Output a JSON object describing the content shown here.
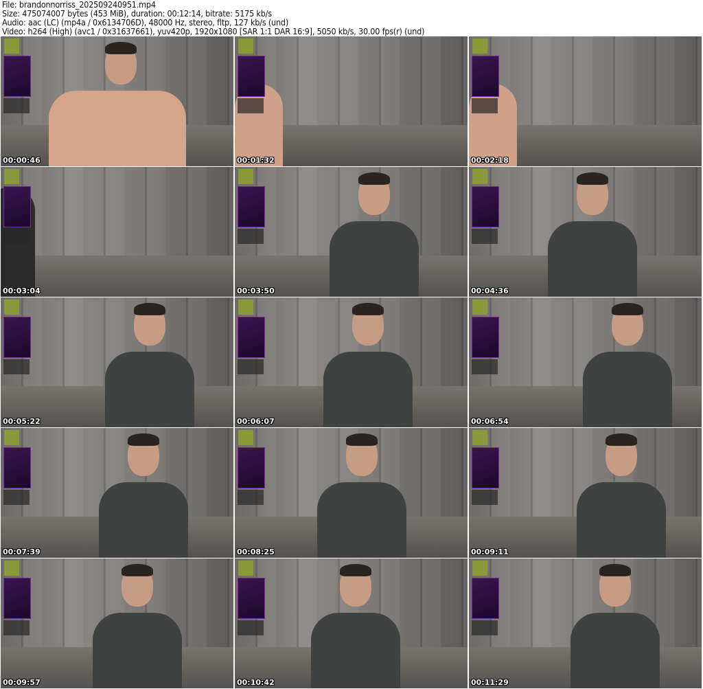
{
  "info": {
    "file": "File: brandonnorriss_202509240951.mp4",
    "size": "Size: 475074007 bytes (453 MiB), duration: 00:12:14, bitrate: 5175 kb/s",
    "audio": "Audio: aac (LC) (mp4a / 0x6134706D), 48000 Hz, stereo, fltp, 127 kb/s (und)",
    "video": "Video: h264 (High) (avc1 / 0x31637661), yuv420p, 1920x1080 [SAR 1:1 DAR 16:9], 5050 kb/s, 30.00 fps(r) (und)"
  },
  "thumbnails": [
    {
      "timestamp": "00:00:46",
      "subject": "shirtless"
    },
    {
      "timestamp": "00:01:32",
      "subject": "arm"
    },
    {
      "timestamp": "00:02:18",
      "subject": "arm"
    },
    {
      "timestamp": "00:03:04",
      "subject": "arm"
    },
    {
      "timestamp": "00:03:50",
      "subject": "tshirt"
    },
    {
      "timestamp": "00:04:36",
      "subject": "tshirt"
    },
    {
      "timestamp": "00:05:22",
      "subject": "tshirt"
    },
    {
      "timestamp": "00:06:07",
      "subject": "tshirt"
    },
    {
      "timestamp": "00:06:54",
      "subject": "tshirt"
    },
    {
      "timestamp": "00:07:39",
      "subject": "tshirt"
    },
    {
      "timestamp": "00:08:25",
      "subject": "tshirt"
    },
    {
      "timestamp": "00:09:11",
      "subject": "tshirt"
    },
    {
      "timestamp": "00:09:57",
      "subject": "tshirt"
    },
    {
      "timestamp": "00:10:42",
      "subject": "tshirt"
    },
    {
      "timestamp": "00:11:29",
      "subject": "tshirt"
    }
  ]
}
